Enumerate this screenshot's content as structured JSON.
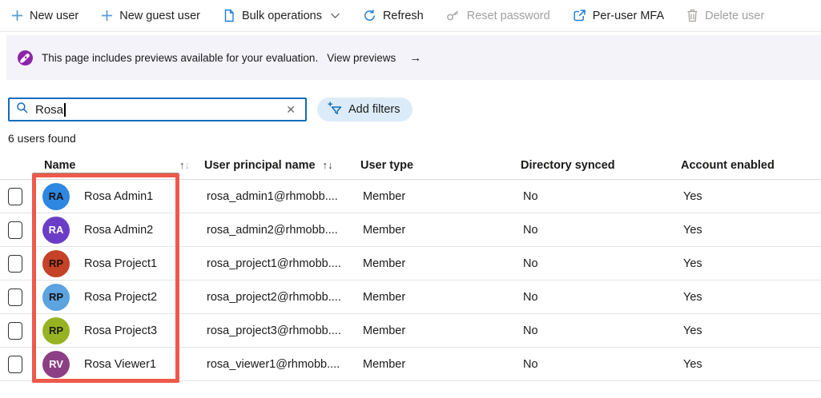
{
  "toolbar": {
    "items": [
      {
        "label": "New user",
        "icon": "plus-icon",
        "enabled": true,
        "has_chevron": false
      },
      {
        "label": "New guest user",
        "icon": "plus-icon",
        "enabled": true,
        "has_chevron": false
      },
      {
        "label": "Bulk operations",
        "icon": "document-icon",
        "enabled": true,
        "has_chevron": true
      },
      {
        "label": "Refresh",
        "icon": "refresh-icon",
        "enabled": true,
        "has_chevron": false
      },
      {
        "label": "Reset password",
        "icon": "key-icon",
        "enabled": false,
        "has_chevron": false
      },
      {
        "label": "Per-user MFA",
        "icon": "external-link-icon",
        "enabled": true,
        "has_chevron": false
      },
      {
        "label": "Delete user",
        "icon": "trash-icon",
        "enabled": false,
        "has_chevron": false
      }
    ]
  },
  "banner": {
    "icon": "rocket-icon",
    "icon_color": "#8e24aa",
    "text": "This page includes previews available for your evaluation.",
    "link": "View previews",
    "arrow": "→"
  },
  "search": {
    "value": "Rosa",
    "clear_glyph": "✕"
  },
  "filters": {
    "label": "Add filters"
  },
  "results_count": "6 users found",
  "glyphs": {
    "sort_up": "↑",
    "sort_down": "↓"
  },
  "table": {
    "columns": [
      {
        "label": "Name"
      },
      {
        "label": "User principal name"
      },
      {
        "label": "User type"
      },
      {
        "label": "Directory synced"
      },
      {
        "label": "Account enabled"
      }
    ],
    "rows": [
      {
        "initials": "RA",
        "name": "Rosa Admin1",
        "upn": "rosa_admin1@rhmobb....",
        "user_type": "Member",
        "directory_synced": "No",
        "account_enabled": "Yes",
        "avatar_bg": "#2e87e0",
        "avatar_fg": "#121212"
      },
      {
        "initials": "RA",
        "name": "Rosa Admin2",
        "upn": "rosa_admin2@rhmobb....",
        "user_type": "Member",
        "directory_synced": "No",
        "account_enabled": "Yes",
        "avatar_bg": "#6b3dc7",
        "avatar_fg": "#ffffff"
      },
      {
        "initials": "RP",
        "name": "Rosa Project1",
        "upn": "rosa_project1@rhmobb....",
        "user_type": "Member",
        "directory_synced": "No",
        "account_enabled": "Yes",
        "avatar_bg": "#c54128",
        "avatar_fg": "#1c1208"
      },
      {
        "initials": "RP",
        "name": "Rosa Project2",
        "upn": "rosa_project2@rhmobb....",
        "user_type": "Member",
        "directory_synced": "No",
        "account_enabled": "Yes",
        "avatar_bg": "#5ca3df",
        "avatar_fg": "#121212"
      },
      {
        "initials": "RP",
        "name": "Rosa Project3",
        "upn": "rosa_project3@rhmobb....",
        "user_type": "Member",
        "directory_synced": "No",
        "account_enabled": "Yes",
        "avatar_bg": "#97b324",
        "avatar_fg": "#1c1c08"
      },
      {
        "initials": "RV",
        "name": "Rosa Viewer1",
        "upn": "rosa_viewer1@rhmobb....",
        "user_type": "Member",
        "directory_synced": "No",
        "account_enabled": "Yes",
        "avatar_bg": "#8c3f84",
        "avatar_fg": "#ffffff"
      }
    ]
  },
  "annotation": {
    "highlight_color": "#ee594b"
  }
}
